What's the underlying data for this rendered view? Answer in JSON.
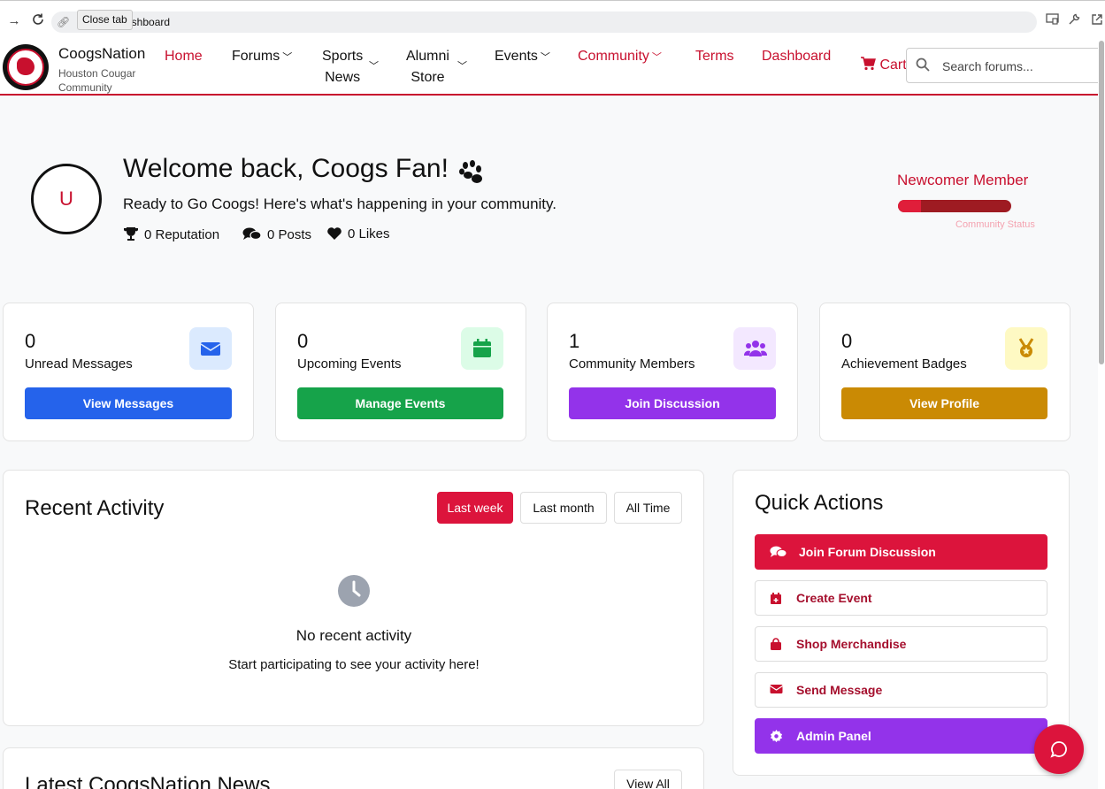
{
  "browser": {
    "url": "ashboard",
    "tooltip": "Close tab"
  },
  "header": {
    "brand_title": "CoogsNation",
    "brand_subtitle": "Houston Cougar Community",
    "nav": {
      "home": "Home",
      "forums": "Forums",
      "sports_line1": "Sports",
      "sports_line2": "News",
      "alumni_line1": "Alumni",
      "alumni_line2": "Store",
      "events": "Events",
      "community": "Community",
      "terms": "Terms",
      "dashboard": "Dashboard",
      "cart": "Cart"
    },
    "search_placeholder": "Search forums..."
  },
  "welcome": {
    "avatar_initial": "U",
    "title": "Welcome back, Coogs Fan!",
    "subtitle": "Ready to Go Coogs! Here's what's happening in your community.",
    "stats": {
      "reputation": "0 Reputation",
      "posts": "0 Posts",
      "likes": "0 Likes"
    },
    "member_level": "Newcomer Member",
    "member_progress": 0.2,
    "member_status_label": "Community Status"
  },
  "cards": [
    {
      "count": "0",
      "label": "Unread Messages",
      "button": "View Messages",
      "icon": "envelope-icon",
      "color": "#2563eb",
      "tint": "#dbeafe"
    },
    {
      "count": "0",
      "label": "Upcoming Events",
      "button": "Manage Events",
      "icon": "calendar-icon",
      "color": "#16a34a",
      "tint": "#dcfce7"
    },
    {
      "count": "1",
      "label": "Community Members",
      "button": "Join Discussion",
      "icon": "users-icon",
      "color": "#9333ea",
      "tint": "#f3e8ff"
    },
    {
      "count": "0",
      "label": "Achievement Badges",
      "button": "View Profile",
      "icon": "medal-icon",
      "color": "#ca8a04",
      "tint": "#fef9c3"
    }
  ],
  "recent_activity": {
    "title": "Recent Activity",
    "filters": [
      "Last week",
      "Last month",
      "All Time"
    ],
    "empty_title": "No recent activity",
    "empty_subtitle": "Start participating to see your activity here!"
  },
  "quick_actions": {
    "title": "Quick Actions",
    "items": [
      {
        "label": "Join Forum Discussion",
        "icon": "comments-icon"
      },
      {
        "label": "Create Event",
        "icon": "calendar-plus-icon"
      },
      {
        "label": "Shop Merchandise",
        "icon": "shopping-bag-icon"
      },
      {
        "label": "Send Message",
        "icon": "envelope-icon"
      },
      {
        "label": "Admin Panel",
        "icon": "gear-icon"
      }
    ]
  },
  "news": {
    "title": "Latest CoogsNation News",
    "view_all": "View All"
  },
  "colors": {
    "brand_red": "#c8102e",
    "accent_red": "#dc143c",
    "purple": "#9333ea"
  }
}
